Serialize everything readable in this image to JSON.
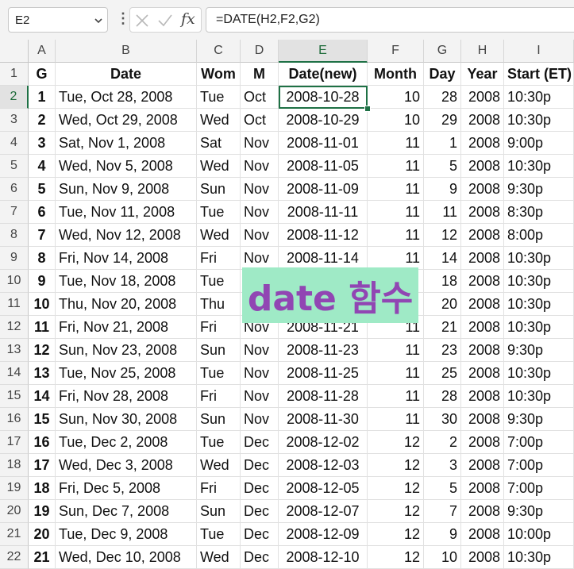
{
  "namebox": {
    "value": "E2"
  },
  "formula": {
    "text": "=DATE(H2,F2,G2)"
  },
  "icons": {
    "dropdown": "chevron-down-icon",
    "more": "vertical-dots-icon",
    "cancel": "cancel-x-icon",
    "enter": "checkmark-icon",
    "fx": "fx"
  },
  "columns": [
    "A",
    "B",
    "C",
    "D",
    "E",
    "F",
    "G",
    "H",
    "I"
  ],
  "header": [
    "G",
    "Date",
    "Wom",
    "M",
    "Date(new)",
    "Month",
    "Day",
    "Year",
    "Start (ET)"
  ],
  "rows": [
    {
      "n": "2",
      "g": "1",
      "date": "Tue, Oct 28, 2008",
      "wom": "Tue",
      "m": "Oct",
      "dnew": "2008-10-28",
      "month": "10",
      "day": "28",
      "year": "2008",
      "start": "10:30p"
    },
    {
      "n": "3",
      "g": "2",
      "date": "Wed, Oct 29, 2008",
      "wom": "Wed",
      "m": "Oct",
      "dnew": "2008-10-29",
      "month": "10",
      "day": "29",
      "year": "2008",
      "start": "10:30p"
    },
    {
      "n": "4",
      "g": "3",
      "date": "Sat, Nov 1, 2008",
      "wom": "Sat",
      "m": "Nov",
      "dnew": "2008-11-01",
      "month": "11",
      "day": "1",
      "year": "2008",
      "start": "9:00p"
    },
    {
      "n": "5",
      "g": "4",
      "date": "Wed, Nov 5, 2008",
      "wom": "Wed",
      "m": "Nov",
      "dnew": "2008-11-05",
      "month": "11",
      "day": "5",
      "year": "2008",
      "start": "10:30p"
    },
    {
      "n": "6",
      "g": "5",
      "date": "Sun, Nov 9, 2008",
      "wom": "Sun",
      "m": "Nov",
      "dnew": "2008-11-09",
      "month": "11",
      "day": "9",
      "year": "2008",
      "start": "9:30p"
    },
    {
      "n": "7",
      "g": "6",
      "date": "Tue, Nov 11, 2008",
      "wom": "Tue",
      "m": "Nov",
      "dnew": "2008-11-11",
      "month": "11",
      "day": "11",
      "year": "2008",
      "start": "8:30p"
    },
    {
      "n": "8",
      "g": "7",
      "date": "Wed, Nov 12, 2008",
      "wom": "Wed",
      "m": "Nov",
      "dnew": "2008-11-12",
      "month": "11",
      "day": "12",
      "year": "2008",
      "start": "8:00p"
    },
    {
      "n": "9",
      "g": "8",
      "date": "Fri, Nov 14, 2008",
      "wom": "Fri",
      "m": "Nov",
      "dnew": "2008-11-14",
      "month": "11",
      "day": "14",
      "year": "2008",
      "start": "10:30p"
    },
    {
      "n": "10",
      "g": "9",
      "date": "Tue, Nov 18, 2008",
      "wom": "Tue",
      "m": "",
      "dnew": "",
      "month": "",
      "day": "18",
      "year": "2008",
      "start": "10:30p"
    },
    {
      "n": "11",
      "g": "10",
      "date": "Thu, Nov 20, 2008",
      "wom": "Thu",
      "m": "",
      "dnew": "",
      "month": "",
      "day": "20",
      "year": "2008",
      "start": "10:30p"
    },
    {
      "n": "12",
      "g": "11",
      "date": "Fri, Nov 21, 2008",
      "wom": "Fri",
      "m": "Nov",
      "dnew": "2008-11-21",
      "month": "11",
      "day": "21",
      "year": "2008",
      "start": "10:30p"
    },
    {
      "n": "13",
      "g": "12",
      "date": "Sun, Nov 23, 2008",
      "wom": "Sun",
      "m": "Nov",
      "dnew": "2008-11-23",
      "month": "11",
      "day": "23",
      "year": "2008",
      "start": "9:30p"
    },
    {
      "n": "14",
      "g": "13",
      "date": "Tue, Nov 25, 2008",
      "wom": "Tue",
      "m": "Nov",
      "dnew": "2008-11-25",
      "month": "11",
      "day": "25",
      "year": "2008",
      "start": "10:30p"
    },
    {
      "n": "15",
      "g": "14",
      "date": "Fri, Nov 28, 2008",
      "wom": "Fri",
      "m": "Nov",
      "dnew": "2008-11-28",
      "month": "11",
      "day": "28",
      "year": "2008",
      "start": "10:30p"
    },
    {
      "n": "16",
      "g": "15",
      "date": "Sun, Nov 30, 2008",
      "wom": "Sun",
      "m": "Nov",
      "dnew": "2008-11-30",
      "month": "11",
      "day": "30",
      "year": "2008",
      "start": "9:30p"
    },
    {
      "n": "17",
      "g": "16",
      "date": "Tue, Dec 2, 2008",
      "wom": "Tue",
      "m": "Dec",
      "dnew": "2008-12-02",
      "month": "12",
      "day": "2",
      "year": "2008",
      "start": "7:00p"
    },
    {
      "n": "18",
      "g": "17",
      "date": "Wed, Dec 3, 2008",
      "wom": "Wed",
      "m": "Dec",
      "dnew": "2008-12-03",
      "month": "12",
      "day": "3",
      "year": "2008",
      "start": "7:00p"
    },
    {
      "n": "19",
      "g": "18",
      "date": "Fri, Dec 5, 2008",
      "wom": "Fri",
      "m": "Dec",
      "dnew": "2008-12-05",
      "month": "12",
      "day": "5",
      "year": "2008",
      "start": "7:00p"
    },
    {
      "n": "20",
      "g": "19",
      "date": "Sun, Dec 7, 2008",
      "wom": "Sun",
      "m": "Dec",
      "dnew": "2008-12-07",
      "month": "12",
      "day": "7",
      "year": "2008",
      "start": "9:30p"
    },
    {
      "n": "21",
      "g": "20",
      "date": "Tue, Dec 9, 2008",
      "wom": "Tue",
      "m": "Dec",
      "dnew": "2008-12-09",
      "month": "12",
      "day": "9",
      "year": "2008",
      "start": "10:00p"
    },
    {
      "n": "22",
      "g": "21",
      "date": "Wed, Dec 10, 2008",
      "wom": "Wed",
      "m": "Dec",
      "dnew": "2008-12-10",
      "month": "12",
      "day": "10",
      "year": "2008",
      "start": "10:30p"
    }
  ],
  "overlay": {
    "text": "date 함수"
  },
  "colors": {
    "accent": "#1e7145",
    "overlay_bg": "#9feac6",
    "overlay_text": "#9146b3"
  }
}
